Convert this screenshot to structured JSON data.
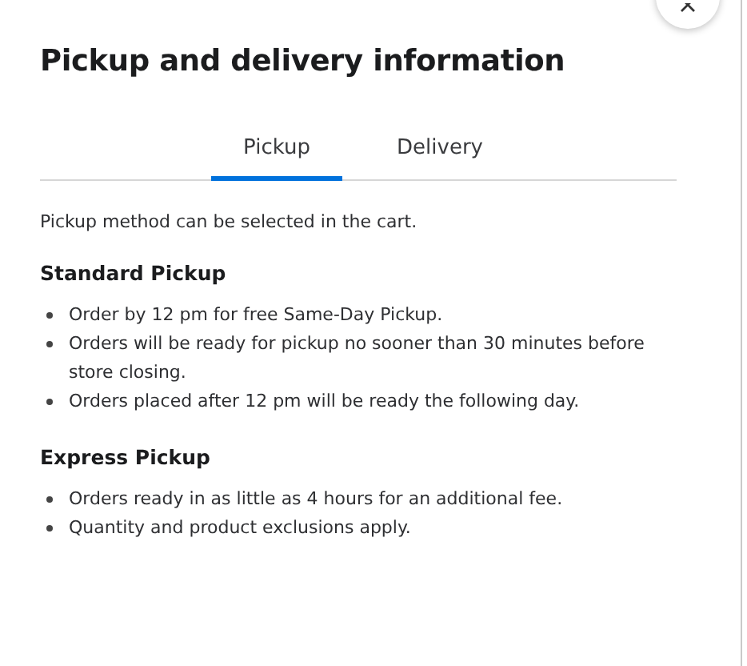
{
  "dialog": {
    "title": "Pickup and delivery information"
  },
  "tabs": [
    {
      "label": "Pickup",
      "selected": true
    },
    {
      "label": "Delivery",
      "selected": false
    }
  ],
  "intro": "Pickup method can be selected in the cart.",
  "sections": [
    {
      "heading": "Standard Pickup",
      "items": [
        "Order by 12 pm for free Same-Day Pickup.",
        "Orders will be ready for pickup no sooner than 30 minutes before store closing.",
        "Orders placed after 12 pm will be ready the following day."
      ]
    },
    {
      "heading": "Express Pickup",
      "items": [
        "Orders ready in as little as 4 hours for an additional fee.",
        "Quantity and product exclusions apply."
      ]
    }
  ]
}
